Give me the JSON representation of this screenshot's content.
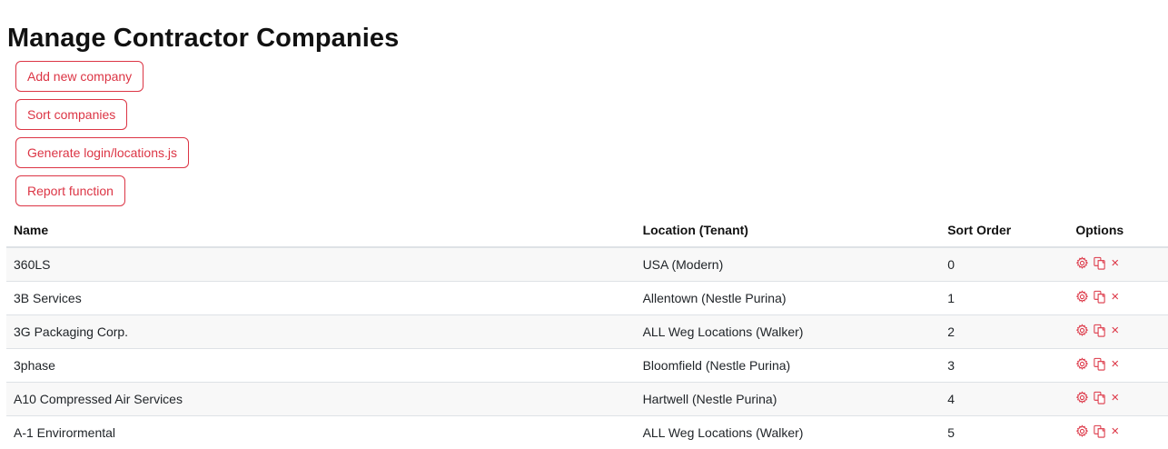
{
  "page": {
    "title": "Manage Contractor Companies"
  },
  "actions": [
    {
      "label": "Add new company",
      "name": "add-new-company-button"
    },
    {
      "label": "Sort companies",
      "name": "sort-companies-button"
    },
    {
      "label": "Generate login/locations.js",
      "name": "generate-login-locations-button"
    },
    {
      "label": "Report function",
      "name": "report-function-button"
    }
  ],
  "table": {
    "headers": {
      "name": "Name",
      "location": "Location (Tenant)",
      "sort_order": "Sort Order",
      "options": "Options"
    },
    "rows": [
      {
        "name": "360LS",
        "location": "USA (Modern)",
        "sort_order": "0"
      },
      {
        "name": "3B Services",
        "location": "Allentown (Nestle Purina)",
        "sort_order": "1"
      },
      {
        "name": "3G Packaging Corp.",
        "location": "ALL Weg Locations (Walker)",
        "sort_order": "2"
      },
      {
        "name": "3phase",
        "location": "Bloomfield (Nestle Purina)",
        "sort_order": "3"
      },
      {
        "name": "A10 Compressed Air Services",
        "location": "Hartwell (Nestle Purina)",
        "sort_order": "4"
      },
      {
        "name": "A-1 Envirormental",
        "location": "ALL Weg Locations (Walker)",
        "sort_order": "5"
      }
    ],
    "row_option_icons": [
      "gear-icon",
      "copy-icon",
      "close-icon"
    ]
  },
  "colors": {
    "accent": "#dc3545",
    "stripe": "#f8f8f8",
    "border": "#dee2e6"
  }
}
